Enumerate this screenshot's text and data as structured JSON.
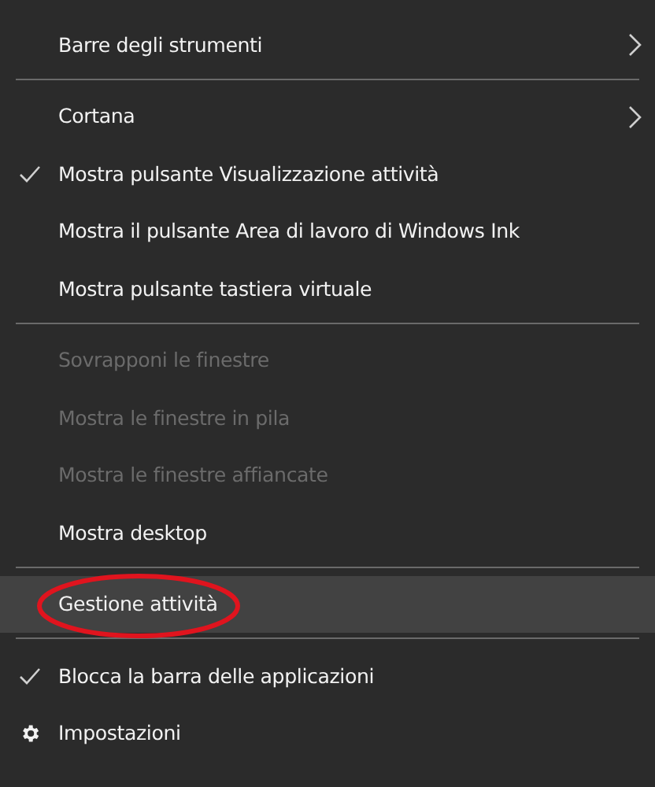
{
  "menu": {
    "sections": [
      {
        "items": [
          {
            "label": "Barre degli strumenti",
            "kind": "submenu",
            "checked": false,
            "disabled": false,
            "selected": false,
            "circled": false
          }
        ]
      },
      {
        "items": [
          {
            "label": "Cortana",
            "kind": "submenu",
            "checked": false,
            "disabled": false,
            "selected": false,
            "circled": false
          },
          {
            "label": "Mostra pulsante Visualizzazione attività",
            "kind": "command",
            "checked": true,
            "disabled": false,
            "selected": false,
            "circled": false
          },
          {
            "label": "Mostra il pulsante Area di lavoro di Windows Ink",
            "kind": "command",
            "checked": false,
            "disabled": false,
            "selected": false,
            "circled": false
          },
          {
            "label": "Mostra pulsante tastiera virtuale",
            "kind": "command",
            "checked": false,
            "disabled": false,
            "selected": false,
            "circled": false
          }
        ]
      },
      {
        "items": [
          {
            "label": "Sovrapponi le finestre",
            "kind": "command",
            "checked": false,
            "disabled": true,
            "selected": false,
            "circled": false
          },
          {
            "label": "Mostra le finestre in pila",
            "kind": "command",
            "checked": false,
            "disabled": true,
            "selected": false,
            "circled": false
          },
          {
            "label": "Mostra le finestre affiancate",
            "kind": "command",
            "checked": false,
            "disabled": true,
            "selected": false,
            "circled": false
          },
          {
            "label": "Mostra desktop",
            "kind": "command",
            "checked": false,
            "disabled": false,
            "selected": false,
            "circled": false
          }
        ]
      },
      {
        "items": [
          {
            "label": "Gestione attività",
            "kind": "command",
            "checked": false,
            "disabled": false,
            "selected": true,
            "circled": true
          }
        ]
      },
      {
        "items": [
          {
            "label": "Blocca la barra delle applicazioni",
            "kind": "command",
            "checked": true,
            "disabled": false,
            "selected": false,
            "circled": false
          },
          {
            "label": "Impostazioni",
            "kind": "settings",
            "checked": false,
            "disabled": false,
            "selected": false,
            "circled": false
          }
        ]
      }
    ]
  }
}
